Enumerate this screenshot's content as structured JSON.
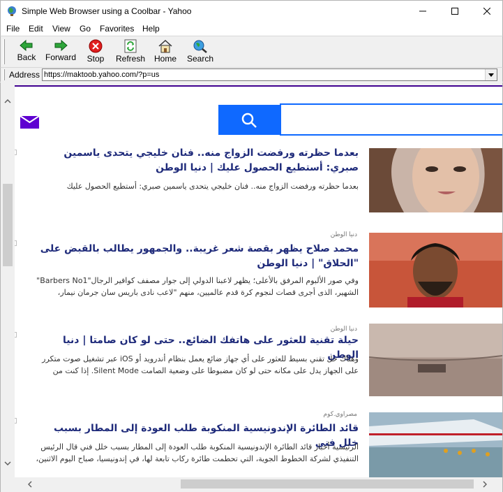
{
  "window": {
    "title": "Simple Web Browser using a Coolbar - Yahoo"
  },
  "menu": {
    "file": "File",
    "edit": "Edit",
    "view": "View",
    "go": "Go",
    "favorites": "Favorites",
    "help": "Help"
  },
  "toolbar": {
    "back": "Back",
    "forward": "Forward",
    "stop": "Stop",
    "refresh": "Refresh",
    "home": "Home",
    "search": "Search"
  },
  "address": {
    "label": "Address",
    "url": "https://maktoob.yahoo.com/?p=us"
  },
  "colors": {
    "accent": "#0f69ff",
    "brand_purple": "#400090",
    "headline": "#1e2a7a"
  },
  "articles": [
    {
      "source": "",
      "headline": "بعدما حظرته ورفضت الزواج منه.. فنان خليجي يتحدى ياسمين صبري: أستطيع الحصول عليك | دنيا الوطن",
      "summary": "بعدما حظرته ورفضت الزواج منه.. فنان خليجي يتحدى ياسمين صبري: أستطيع الحصول عليك"
    },
    {
      "source": "دنيا الوطن",
      "headline": "محمد صلاح يظهر بقصة شعر غريبة.. والجمهور يطالب بالقبض على \"الحلاق\" | دنيا الوطن",
      "summary": "وفي صور الألبوم المرفق بالأعلى؛ يظهر لاعبنا الدولي إلى جوار مصفف كوافير الرجال\"Barbers No1\" الشهير، الذى أجرى قصات لنجوم كرة قدم عالميين، منهم \"لاعب نادى باريس سان جرمان نيمار،"
    },
    {
      "source": "دنيا الوطن",
      "headline": "حيلة تقنية للعثور على هاتفك الضائع.. حتى لو كان صامتا | دنيا الوطن",
      "summary": "وهناك حل تقني بسيط للعثور على أي جهاز ضائع يعمل بنظام أندرويد أو iOS عبر تشغيل صوت متكرر على الجهاز يدل على مكانه حتى لو كان مضبوطا على وضعية الصامت Silent Mode. إذا كنت من"
    },
    {
      "source": "مصراوي.كوم",
      "headline": "قائد الطائرة الإندونيسية المنكوبة طلب العودة إلى المطار بسبب خلل فني",
      "summary": "الرئيسية أخبار قائد الطائرة الإندونيسية المنكوبة طلب العودة إلى المطار بسبب خلل فني قال الرئيس التنفيذي لشركة الخطوط الجوية، التي تحطمت طائرة ركاب تابعة لها، في إندونيسيا، صباح اليوم الاثنين،"
    }
  ]
}
